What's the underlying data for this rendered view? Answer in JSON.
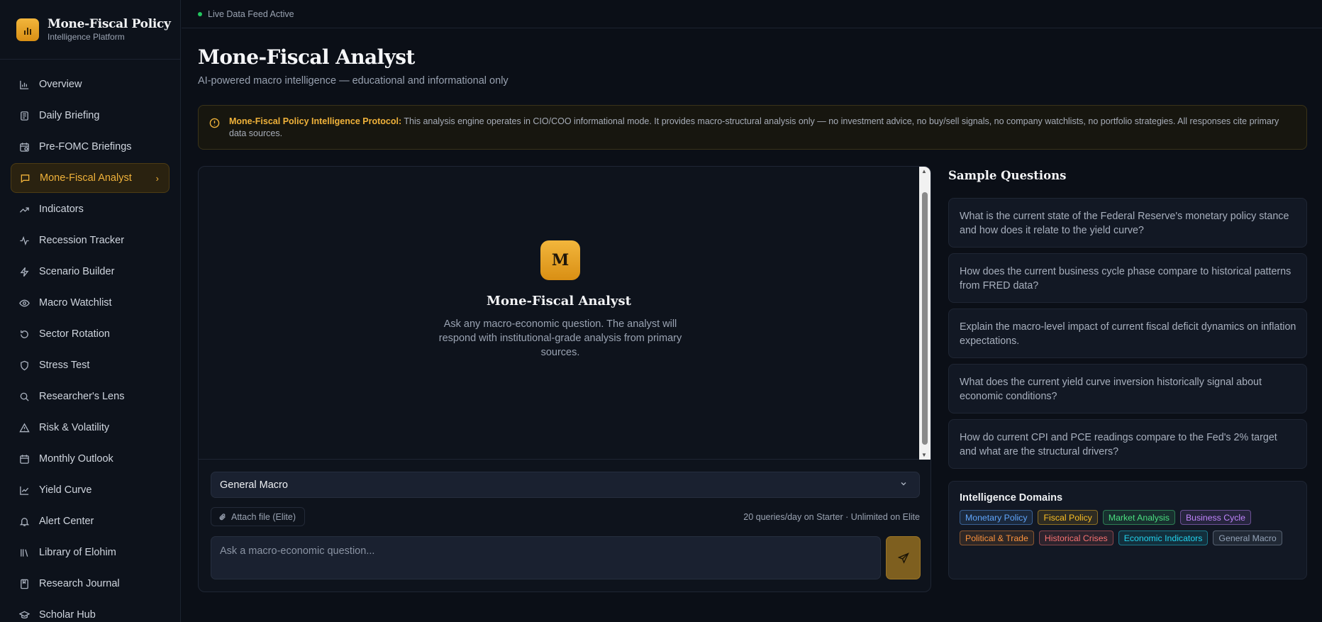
{
  "brand": {
    "title": "Mone-Fiscal Policy",
    "subtitle": "Intelligence Platform"
  },
  "topbar": {
    "status": "Live Data Feed Active"
  },
  "sidebar": {
    "items": [
      {
        "label": "Overview",
        "icon": "bar-chart-icon"
      },
      {
        "label": "Daily Briefing",
        "icon": "newspaper-icon"
      },
      {
        "label": "Pre-FOMC Briefings",
        "icon": "calendar-clock-icon"
      },
      {
        "label": "Mone-Fiscal Analyst",
        "icon": "message-square-icon",
        "active": true
      },
      {
        "label": "Indicators",
        "icon": "trending-up-icon"
      },
      {
        "label": "Recession Tracker",
        "icon": "activity-icon"
      },
      {
        "label": "Scenario Builder",
        "icon": "zap-icon"
      },
      {
        "label": "Macro Watchlist",
        "icon": "eye-icon"
      },
      {
        "label": "Sector Rotation",
        "icon": "rotate-icon"
      },
      {
        "label": "Stress Test",
        "icon": "shield-icon"
      },
      {
        "label": "Researcher's Lens",
        "icon": "search-icon"
      },
      {
        "label": "Risk & Volatility",
        "icon": "alert-triangle-icon"
      },
      {
        "label": "Monthly Outlook",
        "icon": "calendar-icon"
      },
      {
        "label": "Yield Curve",
        "icon": "line-chart-icon"
      },
      {
        "label": "Alert Center",
        "icon": "bell-icon"
      },
      {
        "label": "Library of Elohim",
        "icon": "library-icon"
      },
      {
        "label": "Research Journal",
        "icon": "book-icon"
      },
      {
        "label": "Scholar Hub",
        "icon": "graduation-cap-icon"
      }
    ]
  },
  "header": {
    "title": "Mone-Fiscal Analyst",
    "subtitle": "AI-powered macro intelligence — educational and informational only"
  },
  "protocol": {
    "label": "Mone-Fiscal Policy Intelligence Protocol:",
    "text": " This analysis engine operates in CIO/COO informational mode. It provides macro-structural analysis only — no investment advice, no buy/sell signals, no company watchlists, no portfolio strategies. All responses cite primary data sources."
  },
  "chat": {
    "avatar_letter": "M",
    "empty_title": "Mone-Fiscal Analyst",
    "empty_desc": "Ask any macro-economic question. The analyst will respond with institutional-grade analysis from primary sources.",
    "domain_select": "General Macro",
    "attach_label": "Attach file (Elite)",
    "quota": "20 queries/day on Starter · Unlimited on Elite",
    "input_placeholder": "Ask a macro-economic question..."
  },
  "samples": {
    "title": "Sample Questions",
    "questions": [
      "What is the current state of the Federal Reserve's monetary policy stance and how does it relate to the yield curve?",
      "How does the current business cycle phase compare to historical patterns from FRED data?",
      "Explain the macro-level impact of current fiscal deficit dynamics on inflation expectations.",
      "What does the current yield curve inversion historically signal about economic conditions?",
      "How do current CPI and PCE readings compare to the Fed's 2% target and what are the structural drivers?"
    ]
  },
  "domains": {
    "title": "Intelligence Domains",
    "tags": [
      {
        "label": "Monetary Policy",
        "color": "#60a5fa"
      },
      {
        "label": "Fiscal Policy",
        "color": "#fbbf24"
      },
      {
        "label": "Market Analysis",
        "color": "#4ade80"
      },
      {
        "label": "Business Cycle",
        "color": "#c084fc"
      },
      {
        "label": "Political & Trade",
        "color": "#fb923c"
      },
      {
        "label": "Historical Crises",
        "color": "#f87171"
      },
      {
        "label": "Economic Indicators",
        "color": "#22d3ee"
      },
      {
        "label": "General Macro",
        "color": "#94a3b8"
      }
    ]
  },
  "colors": {
    "accent": "#f0b23a",
    "background": "#0b0f17",
    "live": "#22c55e"
  }
}
